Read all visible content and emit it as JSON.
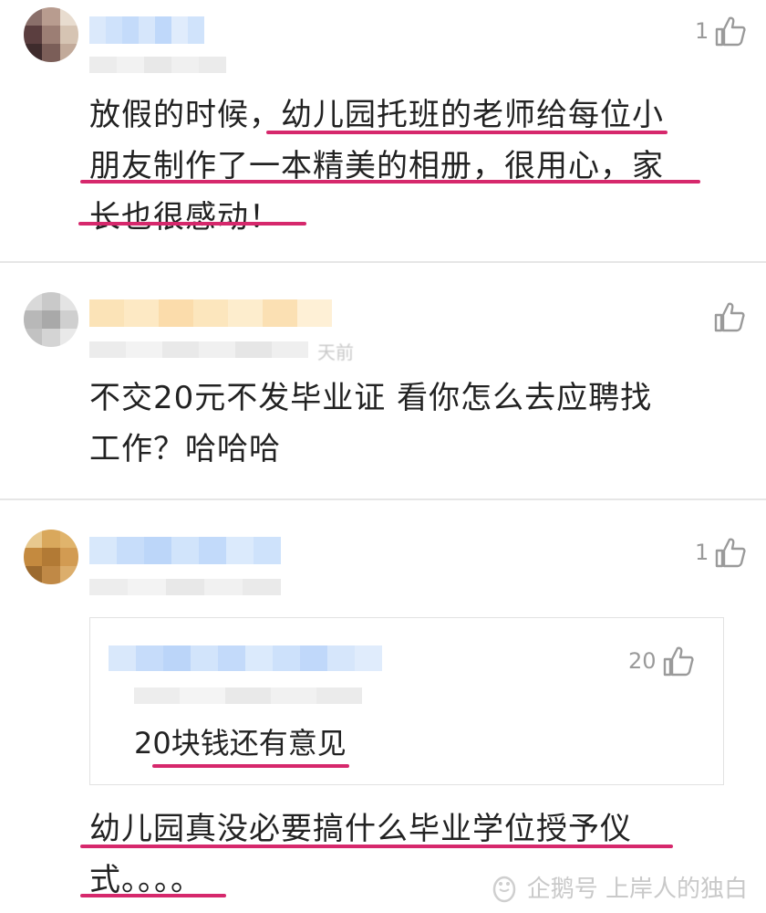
{
  "comments": [
    {
      "likes": "1",
      "text": "放假的时候，幼儿园托班的老师给每位小朋友制作了一本精美的相册，很用心，家长也很感动！",
      "text_lines": [
        "放假的时候，幼儿园托班的老师给每位小",
        "朋友制作了一本精美的相册，很用心，家",
        "长也很感动！"
      ]
    },
    {
      "likes": "",
      "time_fragment": "天前",
      "text_lines": [
        "不交20元不发毕业证 看你怎么去应聘找",
        "工作？哈哈哈"
      ]
    },
    {
      "likes": "1",
      "reply": {
        "likes": "20",
        "text": "20块钱还有意见"
      },
      "text_lines": [
        "幼儿园真没必要搞什么毕业学位授予仪",
        "式。。。。"
      ]
    }
  ],
  "watermark": {
    "text": "企鹅号 上岸人的独白",
    "icon": "penguin-icon"
  },
  "colors": {
    "underline": "#d6286c",
    "like_icon": "#9a9a9a",
    "divider": "#e6e6e6"
  }
}
